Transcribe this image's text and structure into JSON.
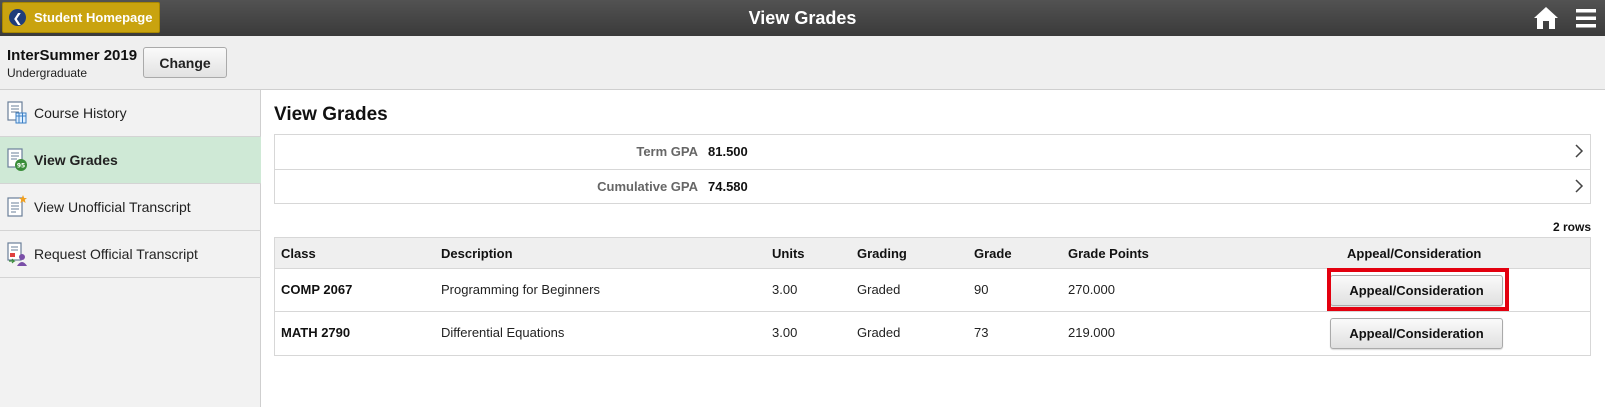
{
  "header": {
    "home_button_label": "Student Homepage",
    "title": "View Grades",
    "home_icon": "home-icon",
    "menu_icon": "hamburger-menu-icon"
  },
  "term": {
    "name": "InterSummer 2019",
    "career": "Undergraduate",
    "change_label": "Change"
  },
  "sidebar": {
    "items": [
      {
        "label": "Course History",
        "icon": "course-history-icon",
        "active": false
      },
      {
        "label": "View Grades",
        "icon": "view-grades-icon",
        "active": true
      },
      {
        "label": "View Unofficial Transcript",
        "icon": "unofficial-transcript-icon",
        "active": false
      },
      {
        "label": "Request Official Transcript",
        "icon": "official-transcript-icon",
        "active": false
      }
    ]
  },
  "main": {
    "title": "View Grades",
    "gpa": [
      {
        "label": "Term GPA",
        "value": "81.500"
      },
      {
        "label": "Cumulative GPA",
        "value": "74.580"
      }
    ],
    "rows_count": "2 rows",
    "columns": [
      "Class",
      "Description",
      "Units",
      "Grading",
      "Grade",
      "Grade Points",
      "Appeal/Consideration"
    ],
    "rows": [
      {
        "class": "COMP 2067",
        "description": "Programming for Beginners",
        "units": "3.00",
        "grading": "Graded",
        "grade": "90",
        "grade_points": "270.000",
        "action": "Appeal/Consideration"
      },
      {
        "class": "MATH 2790",
        "description": "Differential Equations",
        "units": "3.00",
        "grading": "Graded",
        "grade": "73",
        "grade_points": "219.000",
        "action": "Appeal/Consideration"
      }
    ]
  },
  "colors": {
    "header_bg": "#454545",
    "home_button": "#c9a30f",
    "active_item": "#cfe9d6",
    "highlight": "#e3000f"
  }
}
